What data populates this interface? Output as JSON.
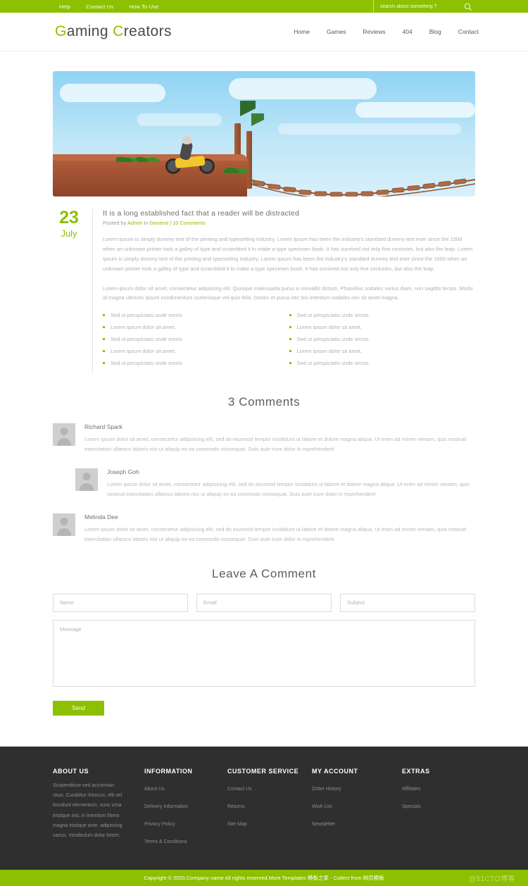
{
  "topbar": {
    "links": [
      {
        "label": "Help"
      },
      {
        "label": "Contact Us"
      },
      {
        "label": "How To Use"
      }
    ],
    "search_placeholder": "search about something ?",
    "search_value": "",
    "search_icon": "search-icon"
  },
  "header": {
    "logo_first_initial": "G",
    "logo_first_rest": "aming ",
    "logo_second_initial": "C",
    "logo_second_rest": "reators",
    "nav": [
      {
        "label": "Home"
      },
      {
        "label": "Games"
      },
      {
        "label": "Reviews"
      },
      {
        "label": "404"
      },
      {
        "label": "Blog"
      },
      {
        "label": "Contact"
      }
    ]
  },
  "post": {
    "hero_alt": "motocross rider on cliff beside rope bridge",
    "date_day": "23",
    "date_month": "July",
    "title": "It is a long established fact that a reader will be distracted",
    "meta_prefix": "Posted by ",
    "meta_author": "Admin",
    "meta_in": " in ",
    "meta_category": "General",
    "meta_sep": " | ",
    "meta_comments": "10 Comments",
    "paragraph_1": "Lorem Ipsum is simply dummy text of the printing and typesetting industry. Lorem Ipsum has been the industry's standard dummy text ever since the 1500 when an unknown printer took a galley of type and scrambled it to make a type specimen book. It has survived not only five centuries, but also the leap. Lorem Ipsum is simply dummy text of the printing and typesetting industry. Lorem Ipsum has been the industry's standard dummy text ever since the 1500 when an unknown printer took a galley of type and scrambled it to make a type specimen book. It has survived not only five centuries, but also the leap.",
    "paragraph_2": "Lorem ipsum dolor sit amet, consectetur adipiscing elit. Quisque malesuada purus a convallis dictum. Phasellus sodales varius diam, non sagittis lectus. Morbi id magna ultricies ipsum condimentum scelerisque vel quis felis. Donec et purus nec leo interdum sodales nec sit amet magna.",
    "list_left": [
      "Sed ut perspiciatis unde omnis",
      "Lorem ipsum dolor sit amet,",
      "Sed ut perspiciatis unde omnis",
      "Lorem ipsum dolor sit amet,",
      "Sed ut perspiciatis unde omnis"
    ],
    "list_right": [
      "Sed ut perspiciatis unde omnis",
      "Lorem ipsum dolor sit amet,",
      "Sed ut perspiciatis unde omnis",
      "Lorem ipsum dolor sit amet,",
      "Sed ut perspiciatis unde omnis"
    ]
  },
  "comments": {
    "heading": "3 Comments",
    "items": [
      {
        "name": "Richard Spark",
        "text": "Lorem ipsum dolor sit amet, consectetur adipisicing elit, sed do eiusmod tempor incididunt ut labore et dolore magna aliqua. Ut enim ad minim veniam, quis nostrud exercitation ullamco laboris nisi ut aliquip ex ea commodo consequat. Duis aute irure dolor in reprehenderit .",
        "nested": false
      },
      {
        "name": "Joseph Goh",
        "text": "Lorem ipsum dolor sit amet, consectetur adipisicing elit, sed do eiusmod tempor incididunt ut labore et dolore magna aliqua. Ut enim ad minim veniam, quis nostrud exercitation ullamco laboris nisi ut aliquip ex ea commodo consequat. Duis aute irure dolor in reprehenderit .",
        "nested": true
      },
      {
        "name": "Melinda Dee",
        "text": "Lorem ipsum dolor sit amet, consectetur adipisicing elit, sed do eiusmod tempor incididunt ut labore et dolore magna aliqua. Ut enim ad minim veniam, quis nostrud exercitation ullamco laboris nisi ut aliquip ex ea commodo consequat. Duis aute irure dolor in reprehenderit .",
        "nested": false
      }
    ]
  },
  "form": {
    "heading": "Leave A Comment",
    "name_placeholder": "Name",
    "name_value": "",
    "email_placeholder": "Email",
    "email_value": "",
    "subject_placeholder": "Subject",
    "subject_value": "",
    "message_placeholder": "Message",
    "message_value": "",
    "send_label": "Send"
  },
  "footer": {
    "columns": [
      {
        "title": "ABOUT US",
        "text": "Suspendisse sed accumsan risus. Curabitur rhoncus, elit vel tincidunt elementum, nunc urna tristique nisi, in interdum libero magna tristique ante. adipiscing varius. Vestibulum dolor lorem.",
        "links": []
      },
      {
        "title": "INFORMATION",
        "text": "",
        "links": [
          "About Us",
          "Delivery Information",
          "Privacy Policy",
          "Terms & Conditions"
        ]
      },
      {
        "title": "CUSTOMER SERVICE",
        "text": "",
        "links": [
          "Contact Us",
          "Returns",
          "Site Map"
        ]
      },
      {
        "title": "MY ACCOUNT",
        "text": "",
        "links": [
          "Order History",
          "Wish List",
          "Newsletter"
        ]
      },
      {
        "title": "EXTRAS",
        "text": "",
        "links": [
          "Affiliates",
          "Specials"
        ]
      }
    ],
    "copyright": "Copyright © 2020.Company name All rights reserved.More Templates 模板之家 - Collect from 网页模板",
    "watermark": "@51CTO博客"
  },
  "colors": {
    "accent_green": "#8cc000",
    "footer_dark": "#2f2f2f",
    "body_text": "#b0b0b0",
    "heading": "#5d5d5d"
  }
}
